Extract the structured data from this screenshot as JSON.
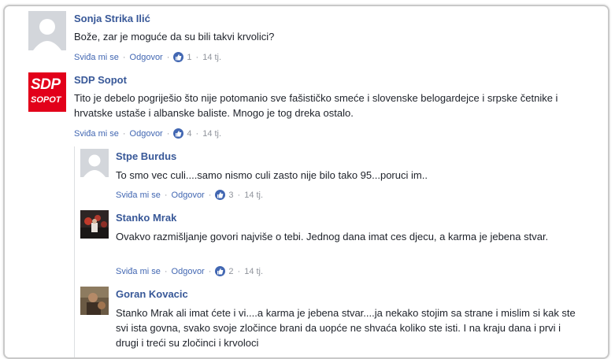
{
  "comments": [
    {
      "author": "Sonja Strika Ilić",
      "text": "Bože, zar je moguće da su bili takvi krvolici?",
      "like": "Sviđa mi se",
      "reply": "Odgovor",
      "reactions": "1",
      "time": "14 tj."
    },
    {
      "author": "SDP Sopot",
      "avatar_text": {
        "top": "SDP",
        "bottom": "SOPOT"
      },
      "text": "Tito je debelo pogriješio što nije potomanio sve fašističko smeće i slovenske belogardejce i srpske četnike i hrvatske ustaše i albanske baliste. Mnogo je tog dreka ostalo.",
      "like": "Sviđa mi se",
      "reply": "Odgovor",
      "reactions": "4",
      "time": "14 tj."
    }
  ],
  "replies": [
    {
      "author": "Stpe Burdus",
      "text": "To smo vec culi....samo nismo culi zasto nije bilo tako 95...poruci im..",
      "like": "Sviđa mi se",
      "reply": "Odgovor",
      "reactions": "3",
      "time": "14 tj."
    },
    {
      "author": "Stanko Mrak",
      "text": "Ovakvo razmišljanje govori najviše o tebi. Jednog dana imat ces djecu, a karma je jebena stvar.",
      "like": "Sviđa mi se",
      "reply": "Odgovor",
      "reactions": "2",
      "time": "14 tj."
    },
    {
      "author": "Goran Kovacic",
      "text": "Stanko Mrak ali imat ćete i vi....a karma je jebena stvar....ja nekako stojim sa strane i mislim si kak ste svi ista govna, svako svoje zločince brani da uopće ne shvaća koliko ste isti. I na kraju dana i prvi i drugi i treći su zločinci i krvoloci"
    }
  ],
  "separator": "·",
  "colors": {
    "name": "#385898",
    "link": "#4267b2",
    "meta": "#90949c",
    "text": "#1d2129",
    "sdp_red": "#e2001a"
  }
}
